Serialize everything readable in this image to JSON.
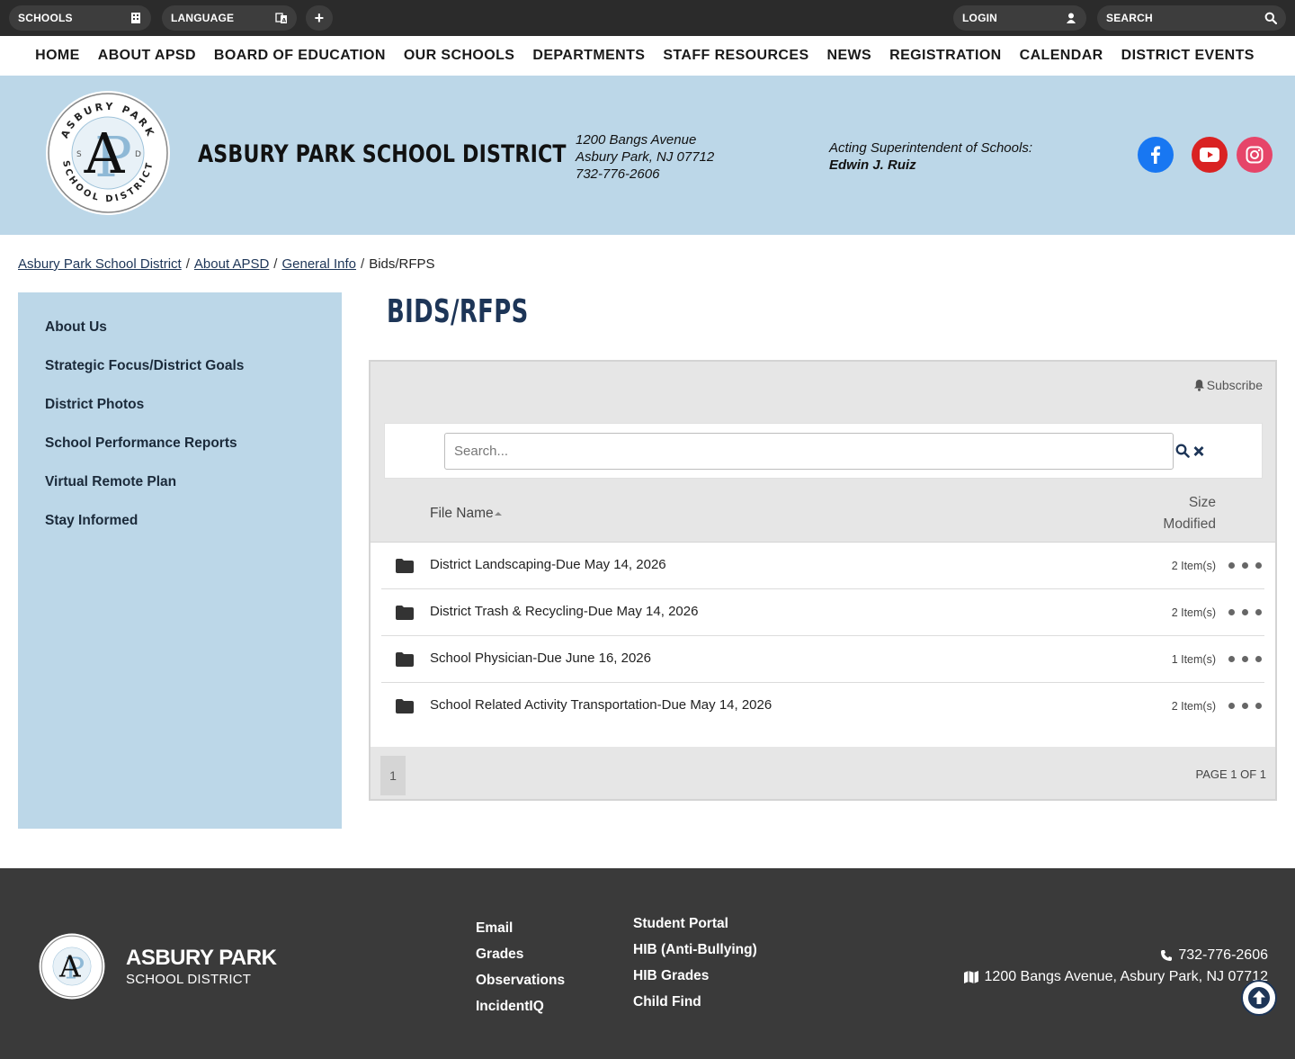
{
  "topbar": {
    "schools_label": "SCHOOLS",
    "language_label": "LANGUAGE",
    "plus_label": "+",
    "login_label": "LOGIN",
    "search_label": "SEARCH"
  },
  "nav": {
    "items": [
      "HOME",
      "ABOUT APSD",
      "BOARD OF EDUCATION",
      "OUR SCHOOLS",
      "DEPARTMENTS",
      "STAFF RESOURCES",
      "NEWS",
      "REGISTRATION",
      "CALENDAR",
      "DISTRICT EVENTS"
    ]
  },
  "header": {
    "district_name": "ASBURY PARK SCHOOL DISTRICT",
    "logo_text_top": "ASBURY PARK",
    "logo_text_bottom": "SCHOOL DISTRICT",
    "address_line1": "1200 Bangs Avenue",
    "address_line2": "Asbury Park, NJ 07712",
    "phone": "732-776-2606",
    "supt_title": "Acting Superintendent of Schools:",
    "supt_name": "Edwin J. Ruiz",
    "social_icons": [
      "facebook-icon",
      "youtube-icon",
      "instagram-icon"
    ]
  },
  "breadcrumb": {
    "items": [
      "Asbury Park School District",
      "About APSD",
      "General Info"
    ],
    "current": "Bids/RFPS",
    "separator": "/"
  },
  "sidebar": {
    "items": [
      "About Us",
      "Strategic Focus/District Goals",
      "District Photos",
      "School Performance Reports",
      "Virtual Remote Plan",
      "Stay Informed"
    ]
  },
  "page": {
    "title": "BIDS/RFPS"
  },
  "files": {
    "subscribe_label": "Subscribe",
    "search_placeholder": "Search...",
    "col_file_name": "File Name",
    "col_size": "Size",
    "col_modified": "Modified",
    "rows": [
      {
        "name": "District Landscaping-Due May 14, 2026",
        "count": "2 Item(s)"
      },
      {
        "name": "District Trash & Recycling-Due May 14, 2026",
        "count": "2 Item(s)"
      },
      {
        "name": "School Physician-Due June 16, 2026",
        "count": "1 Item(s)"
      },
      {
        "name": "School Related Activity Transportation-Due May 14, 2026",
        "count": "2 Item(s)"
      }
    ],
    "page_number": "1",
    "page_label": "PAGE 1 OF 1"
  },
  "footer": {
    "name": "ASBURY PARK",
    "sub": "SCHOOL DISTRICT",
    "links_col1": [
      "Email",
      "Grades",
      "Observations",
      "IncidentIQ"
    ],
    "links_col2": [
      "Student Portal",
      "HIB (Anti-Bullying)",
      "HIB Grades",
      "Child Find"
    ],
    "phone": "732-776-2606",
    "address": "1200 Bangs Avenue, Asbury Park, NJ 07712"
  },
  "colors": {
    "topbar": "#2b2b2b",
    "header_band": "#bcd7e8",
    "sidebar": "#bcd7e8",
    "title": "#1d3557",
    "footer": "#3a3a3a",
    "facebook": "#1877f2",
    "youtube": "#d92222",
    "instagram": "#e64569"
  }
}
